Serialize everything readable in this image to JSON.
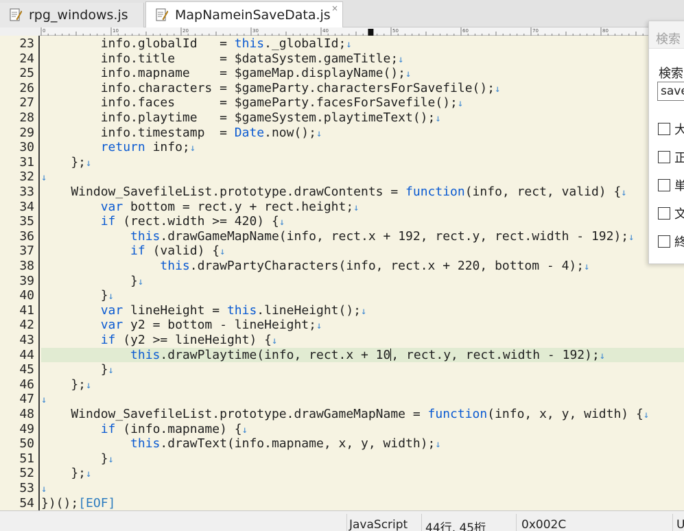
{
  "tabs": [
    {
      "label": "rpg_windows.js",
      "active": false
    },
    {
      "label": "MapNameinSaveData.js",
      "active": true,
      "close": "×"
    }
  ],
  "ruler": {
    "labels": [
      "0",
      "10",
      "20",
      "30",
      "40",
      "50",
      "60",
      "70",
      "80"
    ]
  },
  "editor": {
    "eol_mark": "↓",
    "eof_mark": "[EOF]",
    "current_line": 44,
    "lines": [
      {
        "n": "23",
        "segs": [
          [
            "        info.globalId   = ",
            ""
          ],
          [
            "this",
            "kw"
          ],
          [
            "._globalId;",
            ""
          ]
        ]
      },
      {
        "n": "24",
        "segs": [
          [
            "        info.title      = $dataSystem.gameTitle;",
            ""
          ]
        ]
      },
      {
        "n": "25",
        "segs": [
          [
            "        info.mapname    = $gameMap.displayName();",
            ""
          ]
        ]
      },
      {
        "n": "26",
        "segs": [
          [
            "        info.characters = $gameParty.charactersForSavefile();",
            ""
          ]
        ]
      },
      {
        "n": "27",
        "segs": [
          [
            "        info.faces      = $gameParty.facesForSavefile();",
            ""
          ]
        ]
      },
      {
        "n": "28",
        "segs": [
          [
            "        info.playtime   = $gameSystem.playtimeText();",
            ""
          ]
        ]
      },
      {
        "n": "29",
        "segs": [
          [
            "        info.timestamp  = ",
            ""
          ],
          [
            "Date",
            "kw"
          ],
          [
            ".now();",
            ""
          ]
        ]
      },
      {
        "n": "30",
        "segs": [
          [
            "        ",
            ""
          ],
          [
            "return",
            "kw"
          ],
          [
            " info;",
            ""
          ]
        ]
      },
      {
        "n": "31",
        "segs": [
          [
            "    };",
            ""
          ]
        ]
      },
      {
        "n": "32",
        "segs": []
      },
      {
        "n": "33",
        "segs": [
          [
            "    Window_SavefileList.prototype.drawContents = ",
            ""
          ],
          [
            "function",
            "kw"
          ],
          [
            "(info, rect, valid) {",
            ""
          ]
        ]
      },
      {
        "n": "34",
        "segs": [
          [
            "        ",
            ""
          ],
          [
            "var",
            "kw"
          ],
          [
            " bottom = rect.y + rect.height;",
            ""
          ]
        ]
      },
      {
        "n": "35",
        "segs": [
          [
            "        ",
            ""
          ],
          [
            "if",
            "kw"
          ],
          [
            " (rect.width >= 420) {",
            ""
          ]
        ]
      },
      {
        "n": "36",
        "segs": [
          [
            "            ",
            ""
          ],
          [
            "this",
            "kw"
          ],
          [
            ".drawGameMapName(info, rect.x + 192, rect.y, rect.width - 192);",
            ""
          ]
        ]
      },
      {
        "n": "37",
        "segs": [
          [
            "            ",
            ""
          ],
          [
            "if",
            "kw"
          ],
          [
            " (valid) {",
            ""
          ]
        ]
      },
      {
        "n": "38",
        "segs": [
          [
            "                ",
            ""
          ],
          [
            "this",
            "kw"
          ],
          [
            ".drawPartyCharacters(info, rect.x + 220, bottom - 4);",
            ""
          ]
        ]
      },
      {
        "n": "39",
        "segs": [
          [
            "            }",
            ""
          ]
        ]
      },
      {
        "n": "40",
        "segs": [
          [
            "        }",
            ""
          ]
        ]
      },
      {
        "n": "41",
        "segs": [
          [
            "        ",
            ""
          ],
          [
            "var",
            "kw"
          ],
          [
            " lineHeight = ",
            ""
          ],
          [
            "this",
            "kw"
          ],
          [
            ".lineHeight();",
            ""
          ]
        ]
      },
      {
        "n": "42",
        "segs": [
          [
            "        ",
            ""
          ],
          [
            "var",
            "kw"
          ],
          [
            " y2 = bottom - lineHeight;",
            ""
          ]
        ]
      },
      {
        "n": "43",
        "segs": [
          [
            "        ",
            ""
          ],
          [
            "if",
            "kw"
          ],
          [
            " (y2 >= lineHeight) {",
            ""
          ]
        ]
      },
      {
        "n": "44",
        "segs": [
          [
            "            ",
            ""
          ],
          [
            "this",
            "kw"
          ],
          [
            ".drawPlaytime(info, rect.x + 10",
            ""
          ],
          [
            "",
            "caret"
          ],
          [
            ", rect.y, rect.width - 192);",
            ""
          ]
        ]
      },
      {
        "n": "45",
        "segs": [
          [
            "        }",
            ""
          ]
        ]
      },
      {
        "n": "46",
        "segs": [
          [
            "    };",
            ""
          ]
        ]
      },
      {
        "n": "47",
        "segs": []
      },
      {
        "n": "48",
        "segs": [
          [
            "    Window_SavefileList.prototype.drawGameMapName = ",
            ""
          ],
          [
            "function",
            "kw"
          ],
          [
            "(info, x, y, width) {",
            ""
          ]
        ]
      },
      {
        "n": "49",
        "segs": [
          [
            "        ",
            ""
          ],
          [
            "if",
            "kw"
          ],
          [
            " (info.mapname) {",
            ""
          ]
        ]
      },
      {
        "n": "50",
        "segs": [
          [
            "            ",
            ""
          ],
          [
            "this",
            "kw"
          ],
          [
            ".drawText(info.mapname, x, y, width);",
            ""
          ]
        ]
      },
      {
        "n": "51",
        "segs": [
          [
            "        }",
            ""
          ]
        ]
      },
      {
        "n": "52",
        "segs": [
          [
            "    };",
            ""
          ]
        ]
      },
      {
        "n": "53",
        "segs": []
      },
      {
        "n": "54",
        "segs": [
          [
            "})();",
            ""
          ]
        ],
        "eof": true
      }
    ]
  },
  "statusbar": {
    "language": "JavaScript",
    "position": "44行, 45桁",
    "char_code": "0x002C",
    "encoding": "U"
  },
  "search_panel": {
    "title": "検索",
    "label": "検索",
    "query": "save",
    "options": [
      "大",
      "正",
      "単",
      "文",
      "終"
    ]
  },
  "colors": {
    "keyword": "#0a5ad2",
    "eol": "#3b86d1",
    "editor_bg": "#f6f3e2",
    "current_line_bg": "#e1ebd2"
  }
}
